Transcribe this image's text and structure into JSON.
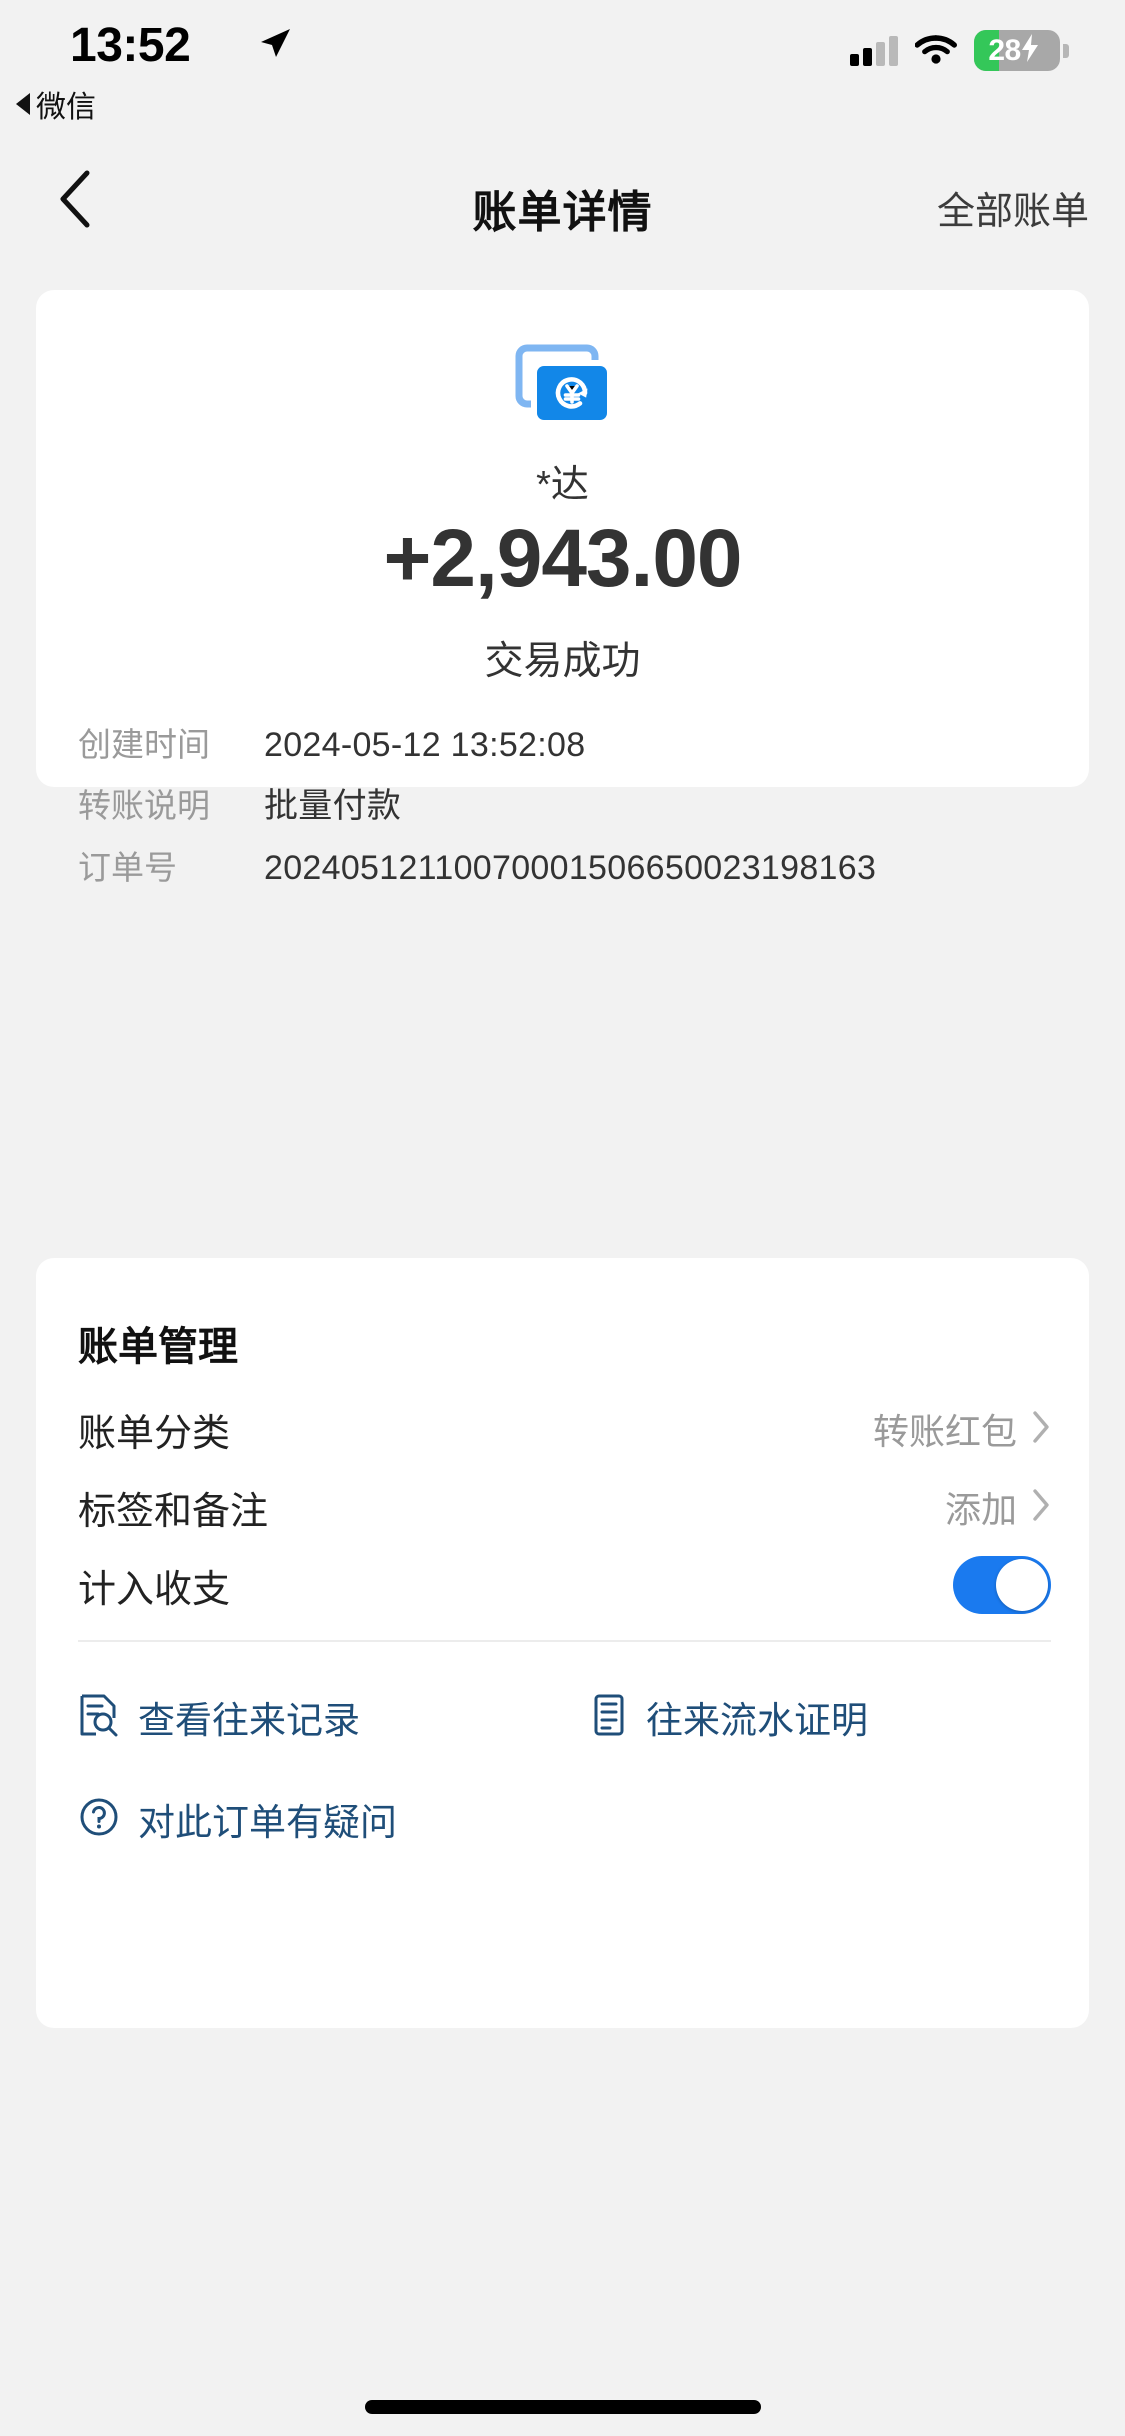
{
  "status_bar": {
    "time": "13:52",
    "back_app_label": "微信",
    "location_icon": "location-arrow-icon",
    "signal_icon": "cellular-signal-icon",
    "wifi_icon": "wifi-icon",
    "battery_level": "28",
    "battery_charging": true
  },
  "nav": {
    "back_icon": "chevron-left-icon",
    "title": "账单详情",
    "right_action": "全部账单"
  },
  "summary": {
    "icon": "transfer-card-icon",
    "payee": "*达",
    "amount": "+2,943.00",
    "status": "交易成功",
    "details": [
      {
        "label": "创建时间",
        "value": "2024-05-12 13:52:08"
      },
      {
        "label": "转账说明",
        "value": "批量付款"
      },
      {
        "label": "订单号",
        "value": "20240512110070001506650023198163"
      }
    ]
  },
  "manage": {
    "heading": "账单管理",
    "rows": [
      {
        "title": "账单分类",
        "value": "转账红包",
        "chevron": "chevron-right-icon"
      },
      {
        "title": "标签和备注",
        "value": "添加",
        "chevron": "chevron-right-icon"
      },
      {
        "title": "计入收支",
        "toggle_on": true
      }
    ],
    "links": [
      {
        "label": "查看往来记录",
        "icon": "document-search-icon"
      },
      {
        "label": "往来流水证明",
        "icon": "document-lines-icon"
      },
      {
        "label": "对此订单有疑问",
        "icon": "question-circle-icon"
      }
    ]
  },
  "colors": {
    "background": "#f2f2f2",
    "card": "#ffffff",
    "accent_blue": "#1a7aef",
    "link_navy": "#1f4e79",
    "amount_text": "#333333",
    "label_gray": "#9a9a9a",
    "battery_green": "#34c759"
  },
  "home_indicator": "home-indicator-bar"
}
